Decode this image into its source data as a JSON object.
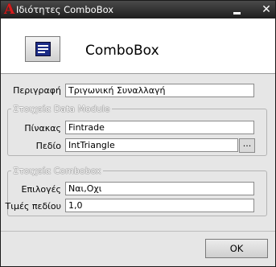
{
  "window": {
    "title": "Ιδιότητες ComboBox",
    "app_icon": "A",
    "minimize_label": "",
    "close_label": "✕"
  },
  "header": {
    "title": "ComboBox",
    "icon": "combobox-icon"
  },
  "description": {
    "label": "Περιγραφή",
    "value": "Τριγωνική Συναλλαγή"
  },
  "data_module": {
    "caption": "Στοιχεία Data Module",
    "table_label": "Πίνακας",
    "table_value": "Fintrade",
    "field_label": "Πεδίο",
    "field_value": "IntTriangle",
    "browse_label": "..."
  },
  "combobox": {
    "caption": "Στοιχεία Combobox",
    "options_label": "Επιλογές",
    "options_value": "Ναι,Οχι",
    "values_label": "Τιμές πεδίου",
    "values_value": "1,0"
  },
  "footer": {
    "ok_label": "OK"
  }
}
